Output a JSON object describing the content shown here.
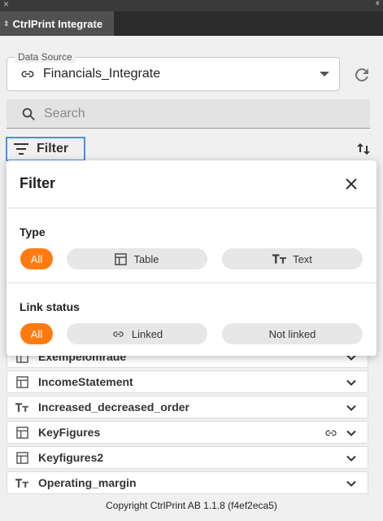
{
  "window": {
    "close_glyph": "×",
    "collapse_glyph": "‹‹"
  },
  "tab": {
    "label": "CtrlPrint Integrate",
    "arrows": "⇕"
  },
  "data_source": {
    "legend": "Data Source",
    "value": "Financials_Integrate"
  },
  "search": {
    "placeholder": "Search"
  },
  "filter_button": {
    "label": "Filter"
  },
  "filter_popup": {
    "title": "Filter",
    "type_section": {
      "title": "Type",
      "options": [
        {
          "label": "All",
          "active": true,
          "icon": null
        },
        {
          "label": "Table",
          "active": false,
          "icon": "table-icon"
        },
        {
          "label": "Text",
          "active": false,
          "icon": "text-type-icon"
        }
      ]
    },
    "link_section": {
      "title": "Link status",
      "options": [
        {
          "label": "All",
          "active": true,
          "icon": null
        },
        {
          "label": "Linked",
          "active": false,
          "icon": "link-icon"
        },
        {
          "label": "Not linked",
          "active": false,
          "icon": null
        }
      ]
    }
  },
  "items": [
    {
      "name": "Exempelomrade",
      "type": "table",
      "linked": false
    },
    {
      "name": "IncomeStatement",
      "type": "table",
      "linked": false
    },
    {
      "name": "Increased_decreased_order",
      "type": "text",
      "linked": false
    },
    {
      "name": "KeyFigures",
      "type": "table",
      "linked": true
    },
    {
      "name": "Keyfigures2",
      "type": "table",
      "linked": false
    },
    {
      "name": "Operating_margin",
      "type": "text",
      "linked": false
    }
  ],
  "footer": {
    "text": "Copyright CtrlPrint AB 1.1.8 (f4ef2eca5)"
  },
  "colors": {
    "accent": "#ff7b10",
    "focus": "#4a8fe0",
    "tab_bg": "#505050"
  }
}
